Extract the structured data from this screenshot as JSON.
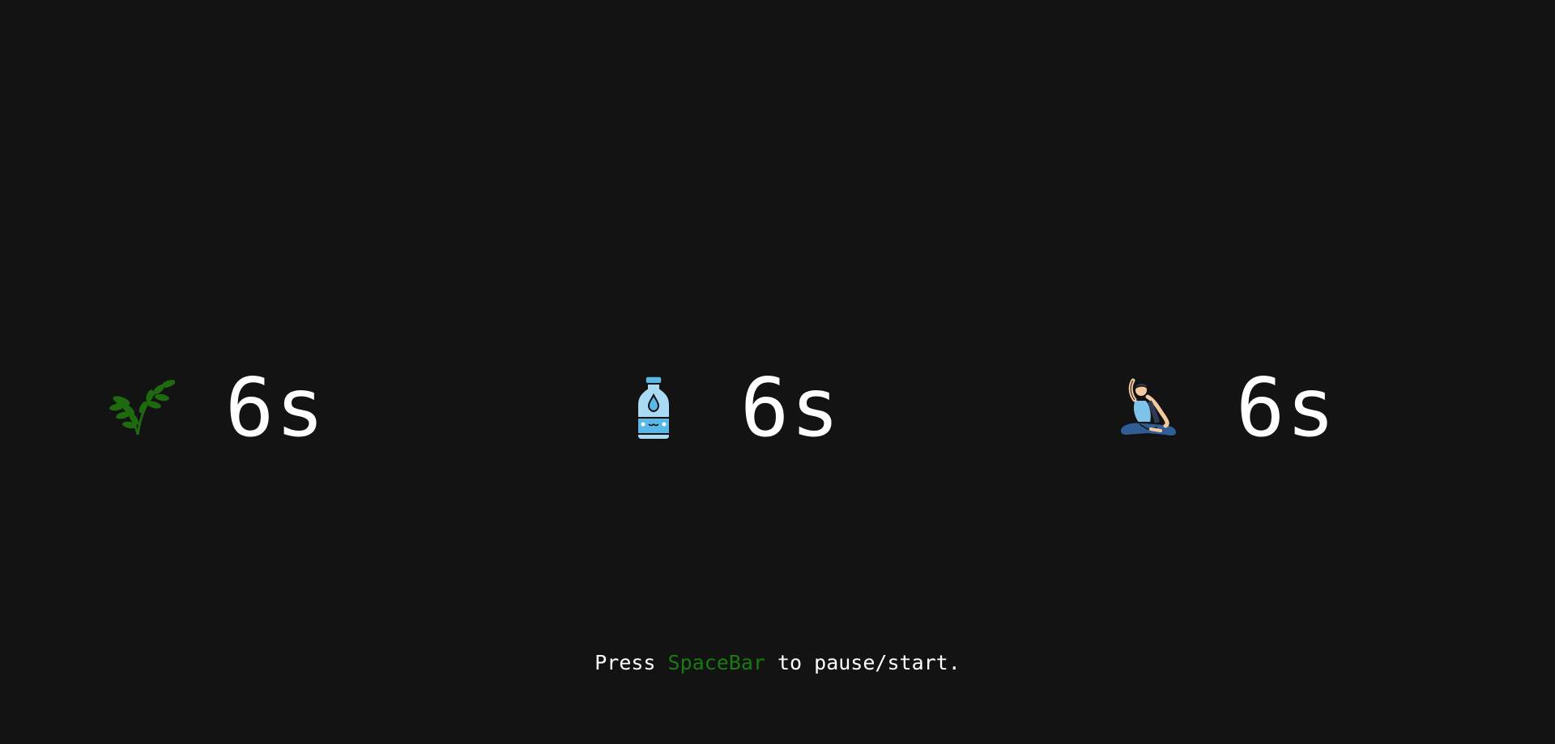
{
  "timers": [
    {
      "icon": "plant-sprig-icon",
      "value": "6s"
    },
    {
      "icon": "water-bottle-icon",
      "value": "6s"
    },
    {
      "icon": "yoga-pose-icon",
      "value": "6s"
    }
  ],
  "hint": {
    "prefix": "Press ",
    "key": "SpaceBar",
    "suffix": " to pause/start."
  },
  "colors": {
    "background": "#131313",
    "text": "#ffffff",
    "accent": "#1a7a12"
  }
}
